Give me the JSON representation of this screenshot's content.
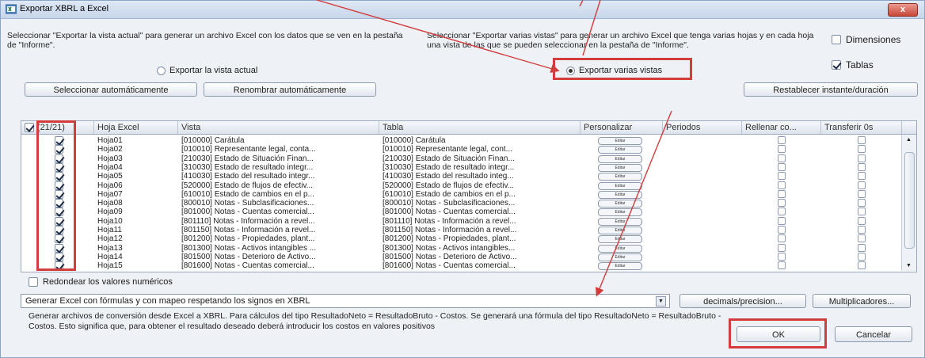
{
  "window": {
    "title": "Exportar XBRL a Excel",
    "close_label": "x"
  },
  "descriptions": {
    "left": "Seleccionar \"Exportar la vista actual\" para generar un archivo Excel con los datos que se ven en la pestaña de \"Informe\".",
    "right": "Seleccionar \"Exportar varias vistas\" para generar un archivo Excel que tenga varias hojas y en cada hoja una vista de las que se pueden seleccionar en la pestaña de \"Informe\"."
  },
  "options": {
    "export_current": "Exportar la vista actual",
    "export_multiple": "Exportar varias vistas",
    "dimensiones": "Dimensiones",
    "tablas": "Tablas"
  },
  "toolbar": {
    "auto_select": "Seleccionar automáticamente",
    "auto_rename": "Renombrar automáticamente",
    "reset_instant": "Restablecer instante/duración"
  },
  "table": {
    "headers": [
      "(21/21)",
      "Hoja Excel",
      "Vista",
      "Tabla",
      "Personalizar",
      "Periodos",
      "Rellenar co...",
      "Transferir 0s"
    ],
    "edit_label": "Editar",
    "rows": [
      {
        "hoja": "Hoja01",
        "vista": "[010000] Carátula",
        "tabla": "[010000] Carátula"
      },
      {
        "hoja": "Hoja02",
        "vista": "[010010] Representante legal, conta...",
        "tabla": "[010010] Representante legal, cont..."
      },
      {
        "hoja": "Hoja03",
        "vista": "[210030] Estado de Situación Finan...",
        "tabla": "[210030] Estado de Situación Finan..."
      },
      {
        "hoja": "Hoja04",
        "vista": "[310030] Estado de resultado integr...",
        "tabla": "[310030] Estado de resultado integr..."
      },
      {
        "hoja": "Hoja05",
        "vista": "[410030] Estado del resultado integr...",
        "tabla": "[410030] Estado del resultado integ..."
      },
      {
        "hoja": "Hoja06",
        "vista": "[520000] Estado de flujos de efectiv...",
        "tabla": "[520000] Estado de flujos de efectiv..."
      },
      {
        "hoja": "Hoja07",
        "vista": "[610010] Estado de cambios en el p...",
        "tabla": "[610010] Estado de cambios en el p..."
      },
      {
        "hoja": "Hoja08",
        "vista": "[800010] Notas - Subclasificaciones...",
        "tabla": "[800010] Notas - Subclasificaciones..."
      },
      {
        "hoja": "Hoja09",
        "vista": "[801000] Notas - Cuentas comercial...",
        "tabla": "[801000] Notas - Cuentas comercial..."
      },
      {
        "hoja": "Hoja10",
        "vista": "[801110] Notas - Información a revel...",
        "tabla": "[801110] Notas - Información a revel..."
      },
      {
        "hoja": "Hoja11",
        "vista": "[801150] Notas - Información a revel...",
        "tabla": "[801150] Notas - Información a revel..."
      },
      {
        "hoja": "Hoja12",
        "vista": "[801200] Notas - Propiedades, plant...",
        "tabla": "[801200] Notas - Propiedades, plant..."
      },
      {
        "hoja": "Hoja13",
        "vista": "[801300] Notas - Activos intangibles ...",
        "tabla": "[801300] Notas - Activos intangibles..."
      },
      {
        "hoja": "Hoja14",
        "vista": "[801500] Notas - Deterioro de Activo...",
        "tabla": "[801500] Notas - Deterioro de Activo..."
      },
      {
        "hoja": "Hoja15",
        "vista": "[801600] Notas - Cuentas comercial...",
        "tabla": "[801600] Notas - Cuentas comercial..."
      }
    ]
  },
  "round_values": "Redondear los valores numéricos",
  "generate_select": "Generar Excel con fórmulas y con mapeo respetando los signos en XBRL",
  "buttons": {
    "decimals": "decimals/precision...",
    "multiplicadores": "Multiplicadores...",
    "ok": "OK",
    "cancel": "Cancelar"
  },
  "footer": "Generar archivos de conversión desde Excel a XBRL. Para cálculos del tipo ResultadoNeto = ResultadoBruto - Costos. Se generará una fórmula del tipo ResultadoNeto = ResultadoBruto - Costos. Esto significa que, para obtener el resultado deseado deberá introducir los costos en valores positivos",
  "colors": {
    "annotation_red": "#d23c3c",
    "window_bg": "#eef2f7"
  }
}
